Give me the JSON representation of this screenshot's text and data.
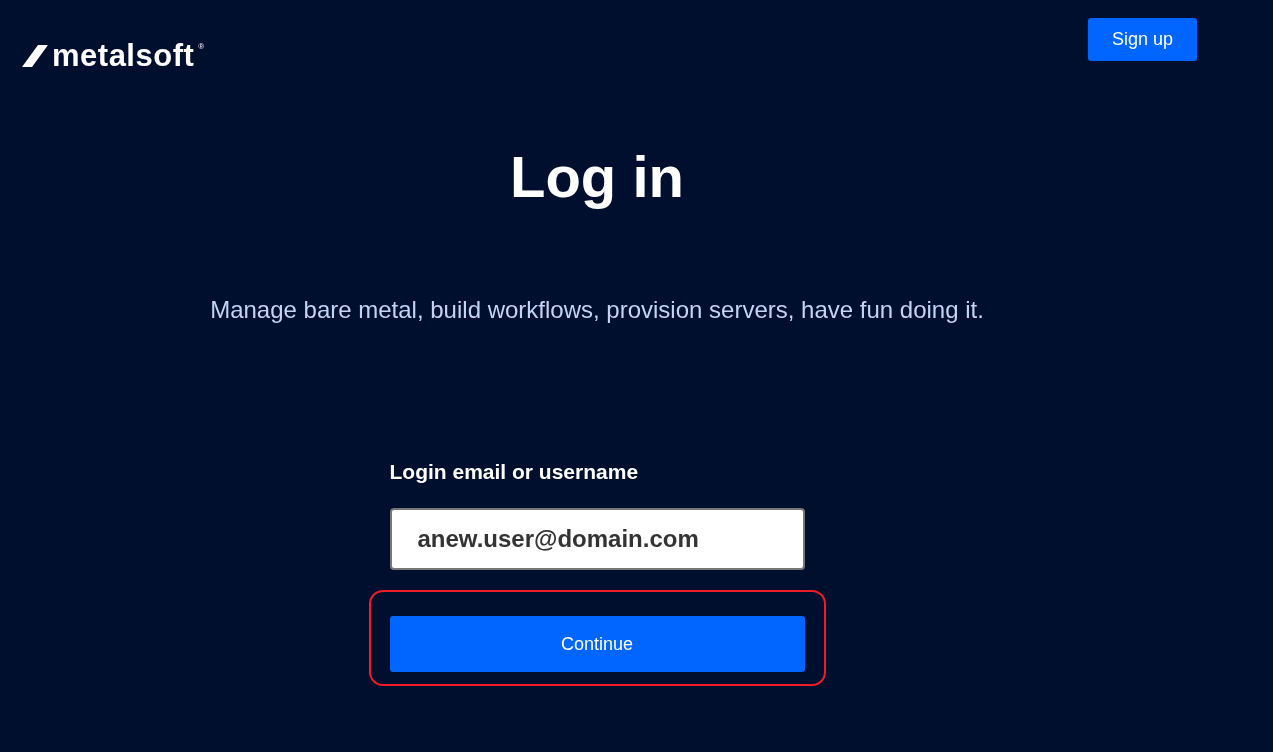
{
  "header": {
    "logo": {
      "wordmark": "metalsoft",
      "registered": "®"
    },
    "signup_button": "Sign up"
  },
  "title": "Log in",
  "tagline": "Manage bare metal, build workflows, provision servers, have fun doing it.",
  "form": {
    "label": "Login email or username",
    "value": "anew.user@domain.com",
    "submit": {
      "label": "Continue",
      "highlighted": true
    }
  }
}
